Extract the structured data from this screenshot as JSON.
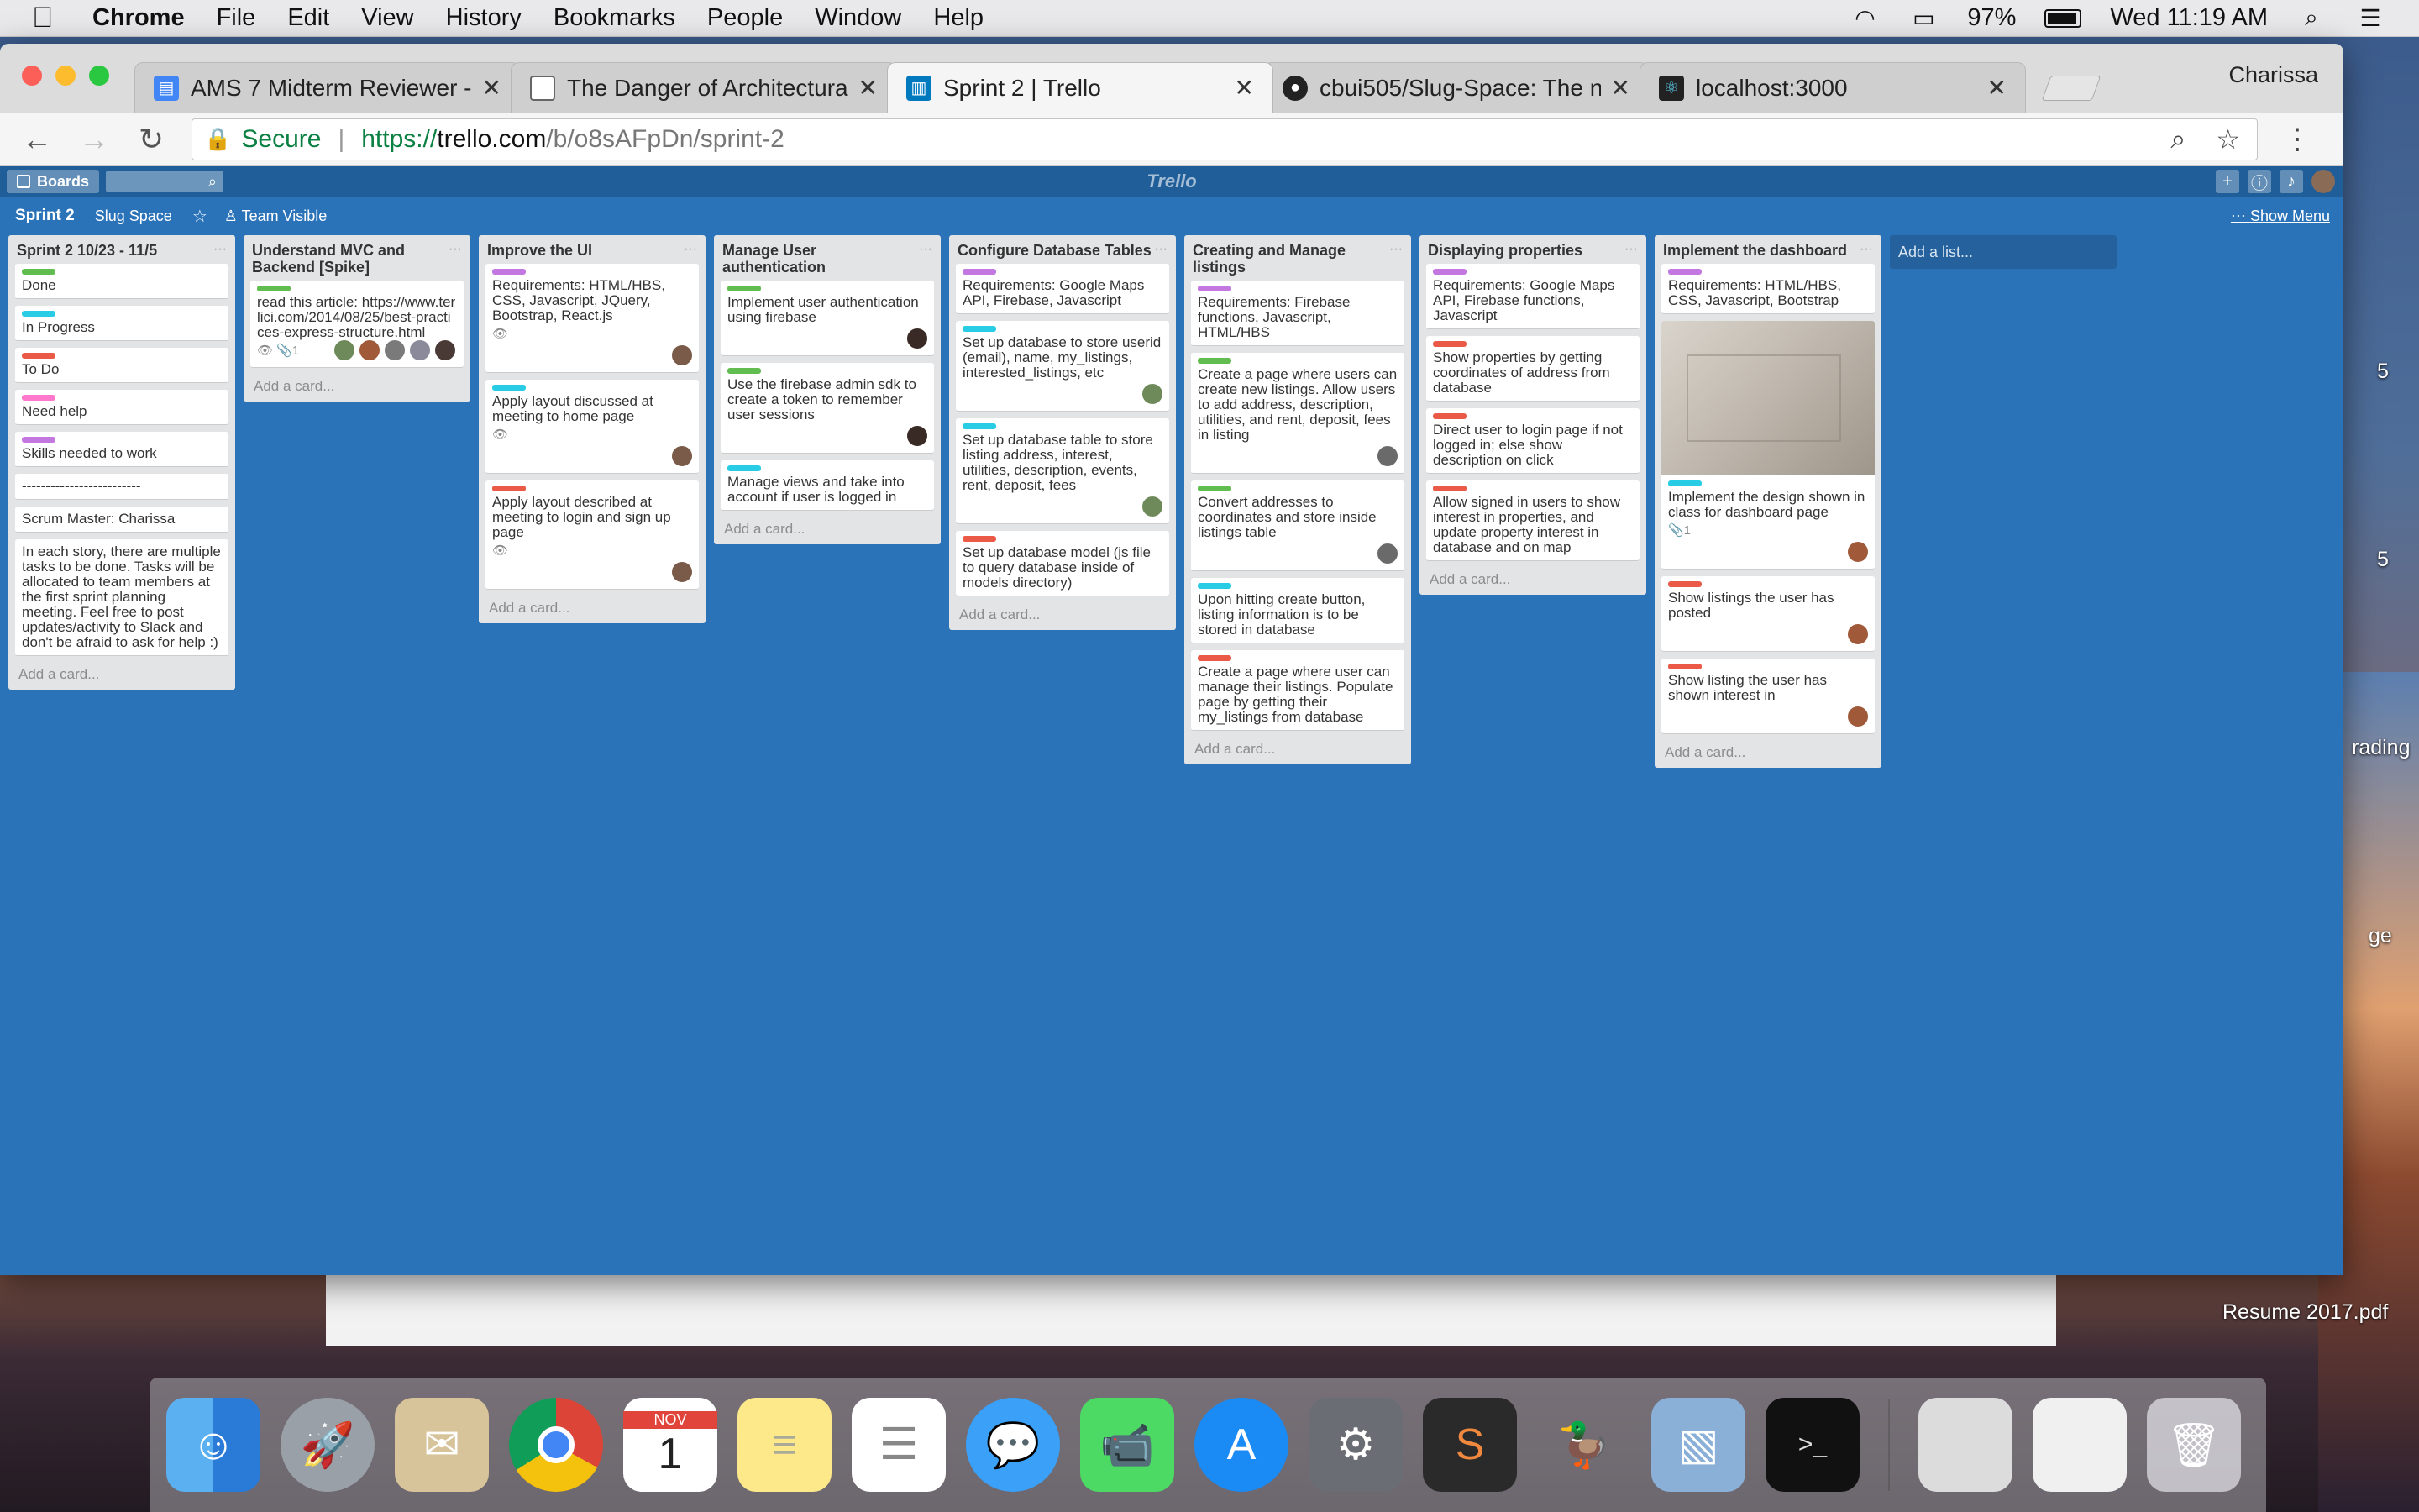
{
  "menubar": {
    "app": "Chrome",
    "items": [
      "File",
      "Edit",
      "View",
      "History",
      "Bookmarks",
      "People",
      "Window",
      "Help"
    ],
    "battery": "97%",
    "clock": "Wed 11:19 AM"
  },
  "browser": {
    "tabs": [
      {
        "title": "AMS 7 Midterm Reviewer - Goo",
        "icon": "docs-icon"
      },
      {
        "title": "The Danger of Architectural Te",
        "icon": "page-icon"
      },
      {
        "title": "Sprint 2 | Trello",
        "icon": "trello-icon"
      },
      {
        "title": "cbui505/Slug-Space: The new",
        "icon": "github-icon"
      },
      {
        "title": "localhost:3000",
        "icon": "react-icon"
      }
    ],
    "profile": "Charissa",
    "secure_label": "Secure",
    "url_scheme": "https://",
    "url_host": "trello.com",
    "url_path": "/b/o8sAFpDn/sprint-2"
  },
  "trello": {
    "boards_label": "Boards",
    "logo": "Trello",
    "board_name": "Sprint 2",
    "team": "Slug Space",
    "visibility": "Team Visible",
    "show_menu": "Show Menu",
    "add_card": "Add a card...",
    "add_list": "Add a list...",
    "lists": [
      {
        "title": "Sprint 2 10/23 - 11/5",
        "cards": [
          {
            "label": "green",
            "text": "Done"
          },
          {
            "label": "sky",
            "text": "In Progress"
          },
          {
            "label": "red",
            "text": "To Do"
          },
          {
            "label": "pink",
            "text": "Need help"
          },
          {
            "label": "purple",
            "text": "Skills needed to work"
          },
          {
            "text": "-------------------------"
          },
          {
            "text": "Scrum Master: Charissa"
          },
          {
            "text": "In each story, there are multiple tasks to be done. Tasks will be allocated to team members at the first sprint planning meeting. Feel free to post updates/activity to Slack and don't be afraid to ask for help :)"
          }
        ]
      },
      {
        "title": "Understand MVC and Backend [Spike]",
        "cards": [
          {
            "label": "green",
            "text": "read this article: https://www.terlici.com/2014/08/25/best-practices-express-structure.html",
            "badges": "👁 📎1"
          }
        ]
      },
      {
        "title": "Improve the UI",
        "cards": [
          {
            "label": "purple",
            "text": "Requirements: HTML/HBS, CSS, Javascript, JQuery, Bootstrap, React.js",
            "badges": "👁"
          },
          {
            "label": "sky",
            "text": "Apply layout discussed at meeting to home page",
            "badges": "👁"
          },
          {
            "label": "red",
            "text": "Apply layout described at meeting to login and sign up page",
            "badges": "👁"
          }
        ]
      },
      {
        "title": "Manage User authentication",
        "cards": [
          {
            "label": "green",
            "text": "Implement user authentication using firebase"
          },
          {
            "label": "green",
            "text": "Use the firebase admin sdk to create a token to remember user sessions"
          },
          {
            "label": "sky",
            "text": "Manage views and take into account if user is logged in"
          }
        ]
      },
      {
        "title": "Configure Database Tables",
        "cards": [
          {
            "label": "purple",
            "text": "Requirements: Google Maps API, Firebase, Javascript"
          },
          {
            "label": "sky",
            "text": "Set up database to store userid (email), name, my_listings, interested_listings, etc"
          },
          {
            "label": "sky",
            "text": "Set up database table to store listing address, interest, utilities, description, events, rent, deposit, fees"
          },
          {
            "label": "red",
            "text": "Set up database model (js file to query database inside of models directory)"
          }
        ]
      },
      {
        "title": "Creating and Manage listings",
        "cards": [
          {
            "label": "purple",
            "text": "Requirements: Firebase functions, Javascript, HTML/HBS"
          },
          {
            "label": "green",
            "text": "Create a page where users can create new listings. Allow users to add address, description, utilities, and rent, deposit, fees in listing"
          },
          {
            "label": "green",
            "text": "Convert addresses to coordinates and store inside listings table"
          },
          {
            "label": "sky",
            "text": "Upon hitting create button, listing information is to be stored in database"
          },
          {
            "label": "red",
            "text": "Create a page where user can manage their listings. Populate page by getting their my_listings from database"
          }
        ]
      },
      {
        "title": "Displaying properties",
        "cards": [
          {
            "label": "purple",
            "text": "Requirements: Google Maps API, Firebase functions, Javascript"
          },
          {
            "label": "red",
            "text": "Show properties by getting coordinates of address from database"
          },
          {
            "label": "red",
            "text": "Direct user to login page if not logged in; else show description on click"
          },
          {
            "label": "red",
            "text": "Allow signed in users to show interest in properties, and update property interest in database and on map"
          }
        ]
      },
      {
        "title": "Implement the dashboard",
        "cards": [
          {
            "label": "purple",
            "text": "Requirements: HTML/HBS, CSS, Javascript, Bootstrap"
          },
          {
            "label": "sky",
            "text": "Implement the design shown in class for dashboard page",
            "badges": "📎1",
            "cover": true
          },
          {
            "label": "red",
            "text": "Show listings the user has posted"
          },
          {
            "label": "red",
            "text": "Show listing the user has shown interest in"
          }
        ]
      }
    ]
  },
  "desktop": {
    "file_label": "Resume 2017.pdf",
    "side_labels": [
      "5",
      "5",
      "rading",
      "ge"
    ]
  },
  "dock": {
    "apps": [
      "Finder",
      "Launchpad",
      "Mail",
      "Chrome",
      "Calendar",
      "Notes",
      "Reminders",
      "Messages",
      "FaceTime",
      "App Store",
      "System Preferences",
      "Sublime",
      "Cyberduck",
      "Preview",
      "Terminal"
    ],
    "calendar_month": "NOV",
    "calendar_day": "1"
  }
}
